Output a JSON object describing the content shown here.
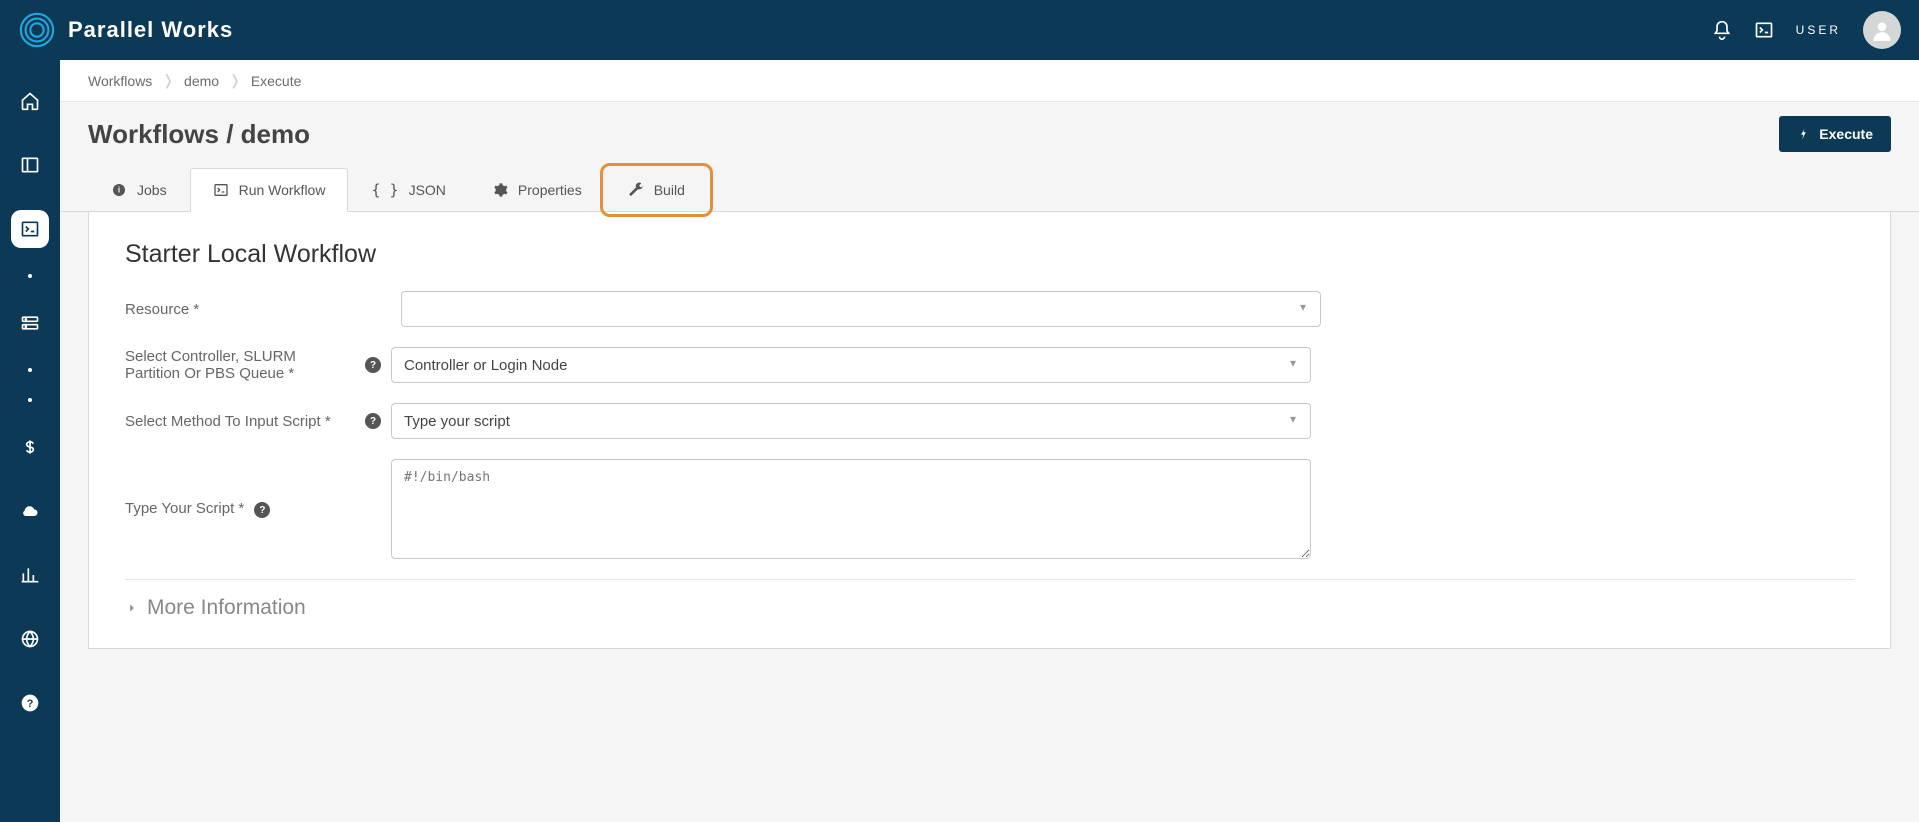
{
  "header": {
    "brand": "Parallel Works",
    "user_label": "USER"
  },
  "breadcrumb": {
    "items": [
      "Workflows",
      "demo",
      "Execute"
    ]
  },
  "page": {
    "title": "Workflows / demo",
    "execute_button": "Execute"
  },
  "tabs": [
    {
      "label": "Jobs",
      "icon": "info"
    },
    {
      "label": "Run Workflow",
      "icon": "terminal",
      "active": true
    },
    {
      "label": "JSON",
      "icon": "braces"
    },
    {
      "label": "Properties",
      "icon": "gear"
    },
    {
      "label": "Build",
      "icon": "wrench",
      "highlight": true
    }
  ],
  "form": {
    "panel_title": "Starter Local Workflow",
    "resource": {
      "label": "Resource *",
      "value": ""
    },
    "controller": {
      "label": "Select Controller, SLURM Partition Or PBS Queue *",
      "value": "Controller or Login Node"
    },
    "method": {
      "label": "Select Method To Input Script *",
      "value": "Type your script"
    },
    "script": {
      "label": "Type Your Script *",
      "placeholder": "#!/bin/bash"
    },
    "more_info_label": "More Information"
  }
}
